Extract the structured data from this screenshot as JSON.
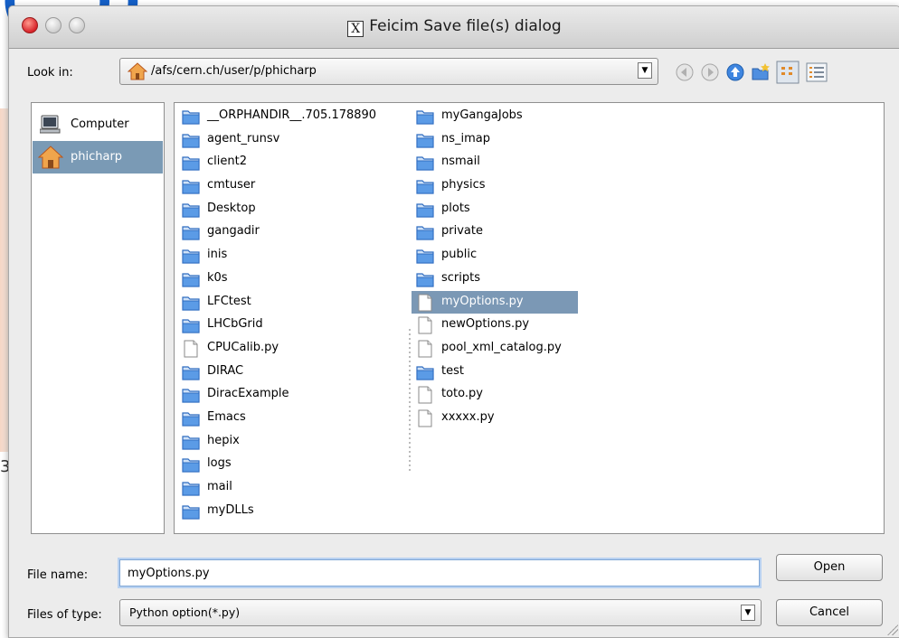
{
  "window": {
    "title": "Feicim Save file(s) dialog"
  },
  "look_in": {
    "label": "Look in:",
    "path": "/afs/cern.ch/user/p/phicharp"
  },
  "toolbar": [
    "back-icon",
    "forward-icon",
    "up-folder-icon",
    "new-folder-icon",
    "list-view-icon",
    "details-view-icon"
  ],
  "places": [
    {
      "label": "Computer",
      "icon": "computer-icon",
      "selected": false
    },
    {
      "label": "phicharp",
      "icon": "home-icon",
      "selected": true
    }
  ],
  "files_col1": [
    {
      "name": "__ORPHANDIR__.705.178890",
      "type": "folder"
    },
    {
      "name": "agent_runsv",
      "type": "folder"
    },
    {
      "name": "client2",
      "type": "folder"
    },
    {
      "name": "cmtuser",
      "type": "folder"
    },
    {
      "name": "Desktop",
      "type": "folder"
    },
    {
      "name": "gangadir",
      "type": "folder"
    },
    {
      "name": "inis",
      "type": "folder"
    },
    {
      "name": "k0s",
      "type": "folder"
    },
    {
      "name": "LFCtest",
      "type": "folder"
    },
    {
      "name": "LHCbGrid",
      "type": "folder"
    },
    {
      "name": "CPUCalib.py",
      "type": "file"
    },
    {
      "name": "DIRAC",
      "type": "folder"
    },
    {
      "name": "DiracExample",
      "type": "folder"
    },
    {
      "name": "Emacs",
      "type": "folder"
    },
    {
      "name": "hepix",
      "type": "folder"
    },
    {
      "name": "logs",
      "type": "folder"
    },
    {
      "name": "mail",
      "type": "folder"
    },
    {
      "name": "myDLLs",
      "type": "folder"
    }
  ],
  "files_col2": [
    {
      "name": "myGangaJobs",
      "type": "folder"
    },
    {
      "name": "ns_imap",
      "type": "folder"
    },
    {
      "name": "nsmail",
      "type": "folder"
    },
    {
      "name": "physics",
      "type": "folder"
    },
    {
      "name": "plots",
      "type": "folder"
    },
    {
      "name": "private",
      "type": "folder"
    },
    {
      "name": "public",
      "type": "folder"
    },
    {
      "name": "scripts",
      "type": "folder"
    },
    {
      "name": "myOptions.py",
      "type": "file",
      "selected": true
    },
    {
      "name": "newOptions.py",
      "type": "file"
    },
    {
      "name": "pool_xml_catalog.py",
      "type": "file"
    },
    {
      "name": "test",
      "type": "folder"
    },
    {
      "name": "toto.py",
      "type": "file"
    },
    {
      "name": "xxxxx.py",
      "type": "file"
    }
  ],
  "file_name": {
    "label": "File name:",
    "value": "myOptions.py"
  },
  "file_type": {
    "label": "Files of type:",
    "value": "Python option(*.py)"
  },
  "buttons": {
    "open": "Open",
    "cancel": "Cancel"
  },
  "background": {
    "bracket_text": "(…))",
    "digit": "3"
  },
  "colors": {
    "selection": "#7b98b5",
    "folder_blue": "#3c7fd6",
    "accent_focus": "#7fa6d6"
  }
}
